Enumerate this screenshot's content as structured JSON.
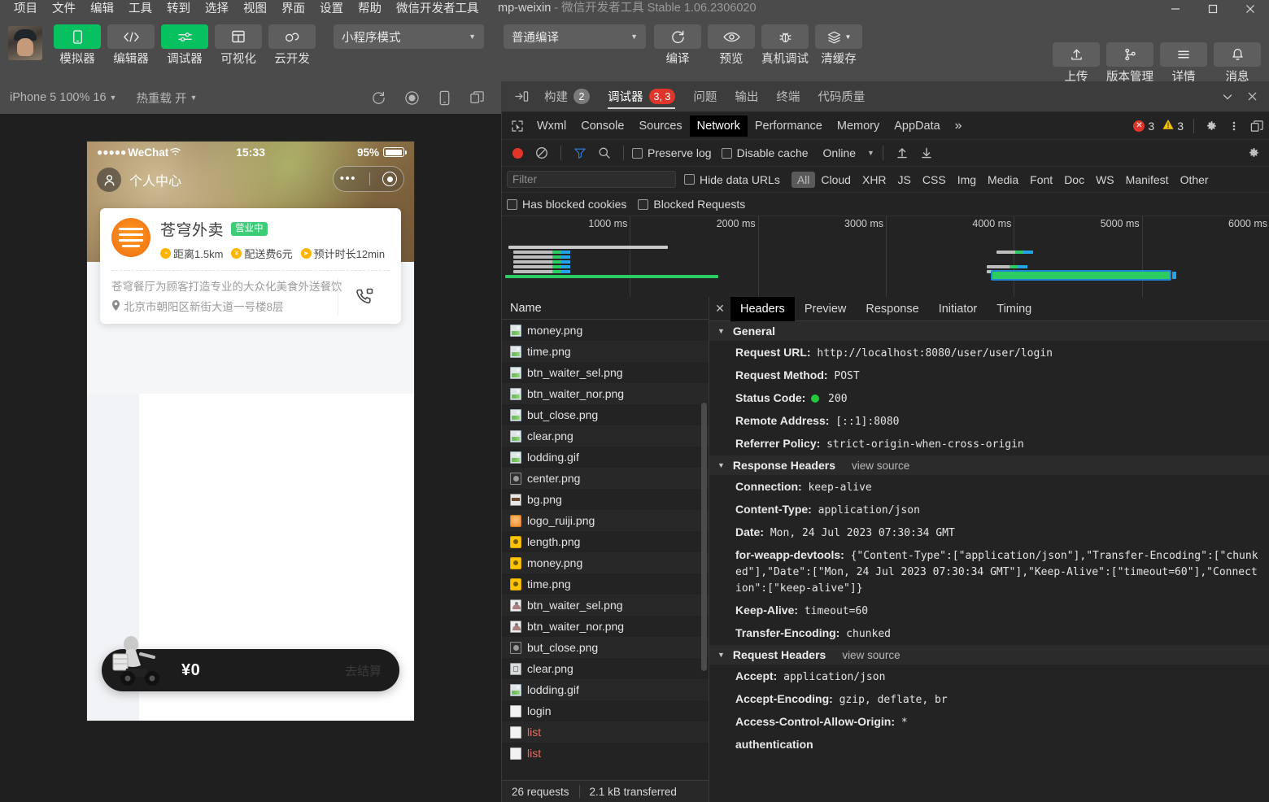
{
  "titlebar": {
    "menus": [
      "项目",
      "文件",
      "编辑",
      "工具",
      "转到",
      "选择",
      "视图",
      "界面",
      "设置",
      "帮助",
      "微信开发者工具"
    ],
    "project": "mp-weixin",
    "app_title": "微信开发者工具 Stable 1.06.2306020",
    "minimize": "—",
    "maximize": "▢",
    "close": "✕"
  },
  "toolbar": {
    "left_buttons": [
      {
        "label": "模拟器",
        "icon": "phone-icon",
        "accent": true
      },
      {
        "label": "编辑器",
        "icon": "code-icon",
        "accent": false
      },
      {
        "label": "调试器",
        "icon": "sliders-icon",
        "accent": true
      },
      {
        "label": "可视化",
        "icon": "layout-icon",
        "accent": false
      },
      {
        "label": "云开发",
        "icon": "cloud-icon",
        "accent": false
      }
    ],
    "mode_select": "小程序模式",
    "compile_select": "普通编译",
    "compile_buttons": [
      {
        "label": "编译",
        "icon": "refresh-icon"
      },
      {
        "label": "预览",
        "icon": "eye-icon"
      },
      {
        "label": "真机调试",
        "icon": "bug-icon"
      },
      {
        "label": "清缓存",
        "icon": "layers-icon"
      }
    ],
    "right_buttons": [
      {
        "label": "上传",
        "icon": "upload-icon"
      },
      {
        "label": "版本管理",
        "icon": "branch-icon"
      },
      {
        "label": "详情",
        "icon": "menu-icon"
      },
      {
        "label": "消息",
        "icon": "bell-icon"
      }
    ]
  },
  "simulator": {
    "device_select": "iPhone 5 100% 16",
    "hotreload_select": "热重载 开",
    "icons": [
      "refresh-icon",
      "record-icon",
      "device-icon",
      "windows-icon"
    ],
    "status": {
      "carrier": "WeChat",
      "dots": "●●●●●",
      "wifi": "wifi-icon",
      "time": "15:33",
      "battery_pct": "95%"
    },
    "nav": {
      "title": "个人中心",
      "avatar_icon": "user-icon",
      "capsule_dots": "•••",
      "capsule_target": "target-icon"
    },
    "shop": {
      "name": "苍穹外卖",
      "badge": "营业中",
      "meta": [
        {
          "icon": "clock-icon",
          "text": "距离1.5km"
        },
        {
          "icon": "yuan-icon",
          "text": "配送费6元"
        },
        {
          "icon": "send-icon",
          "text": "预计时长12min"
        }
      ],
      "desc": "苍穹餐厅为顾客打造专业的大众化美食外送餐饮",
      "address": "北京市朝阳区新街大道一号楼8层",
      "phone_icon": "phone-call-icon"
    },
    "cart": {
      "price": "¥0",
      "action": "去结算"
    }
  },
  "devtools": {
    "outer_tabs": [
      {
        "label": "构建",
        "badge": "2",
        "badge_color": "gray",
        "active": false
      },
      {
        "label": "调试器",
        "badge": "3, 3",
        "badge_color": "red",
        "active": true
      },
      {
        "label": "问题",
        "badge": "",
        "active": false
      },
      {
        "label": "输出",
        "badge": "",
        "active": false
      },
      {
        "label": "终端",
        "badge": "",
        "active": false
      },
      {
        "label": "代码质量",
        "badge": "",
        "active": false
      }
    ],
    "outer_right_icons": [
      "chevron-down-icon",
      "close-icon"
    ],
    "panel_tabs": [
      {
        "label": "Wxml",
        "active": false
      },
      {
        "label": "Console",
        "active": false
      },
      {
        "label": "Sources",
        "active": false
      },
      {
        "label": "Network",
        "active": true
      },
      {
        "label": "Performance",
        "active": false
      },
      {
        "label": "Memory",
        "active": false
      },
      {
        "label": "AppData",
        "active": false
      }
    ],
    "panel_more": "»",
    "error_count": "3",
    "warning_count": "3",
    "panel_right_icons": [
      "gear-icon",
      "kebab-icon",
      "dock-icon"
    ],
    "network_toolbar": {
      "record_icon": "record-icon",
      "clear_icon": "clear-icon",
      "filter_icon": "filter-icon",
      "search_icon": "search-icon",
      "preserve_log": "Preserve log",
      "disable_cache": "Disable cache",
      "throttling": "Online",
      "import_icon": "upload-arrow-icon",
      "export_icon": "download-arrow-icon",
      "settings_icon": "gear-icon"
    },
    "filter_row": {
      "placeholder": "Filter",
      "hide_data_urls": "Hide data URLs",
      "types": [
        "All",
        "Cloud",
        "XHR",
        "JS",
        "CSS",
        "Img",
        "Media",
        "Font",
        "Doc",
        "WS",
        "Manifest",
        "Other"
      ],
      "active_type": "All"
    },
    "blocked_row": {
      "has_blocked_cookies": "Has blocked cookies",
      "blocked_requests": "Blocked Requests"
    },
    "overview": {
      "ticks": [
        "1000 ms",
        "2000 ms",
        "3000 ms",
        "4000 ms",
        "5000 ms",
        "6000 ms"
      ],
      "max_ms": 6000
    },
    "list": {
      "header": "Name",
      "rows": [
        {
          "name": "money.png",
          "icon": "image-icon",
          "error": false
        },
        {
          "name": "time.png",
          "icon": "image-icon",
          "error": false
        },
        {
          "name": "btn_waiter_sel.png",
          "icon": "image-icon",
          "error": false
        },
        {
          "name": "btn_waiter_nor.png",
          "icon": "image-icon",
          "error": false
        },
        {
          "name": "but_close.png",
          "icon": "image-icon",
          "error": false
        },
        {
          "name": "clear.png",
          "icon": "image-icon",
          "error": false
        },
        {
          "name": "lodding.gif",
          "icon": "image-icon",
          "error": false
        },
        {
          "name": "center.png",
          "icon": "circle-icon",
          "error": false
        },
        {
          "name": "bg.png",
          "icon": "bg-icon",
          "error": false
        },
        {
          "name": "logo_ruiji.png",
          "icon": "orange-icon",
          "error": false
        },
        {
          "name": "length.png",
          "icon": "yellow-icon",
          "error": false
        },
        {
          "name": "money.png",
          "icon": "yellow-icon",
          "error": false
        },
        {
          "name": "time.png",
          "icon": "yellow-icon",
          "error": false
        },
        {
          "name": "btn_waiter_sel.png",
          "icon": "person-icon",
          "error": false
        },
        {
          "name": "btn_waiter_nor.png",
          "icon": "person-icon",
          "error": false
        },
        {
          "name": "but_close.png",
          "icon": "circle-icon",
          "error": false
        },
        {
          "name": "clear.png",
          "icon": "clear-icon",
          "error": false
        },
        {
          "name": "lodding.gif",
          "icon": "image-icon",
          "error": false
        },
        {
          "name": "login",
          "icon": "doc-icon",
          "error": false
        },
        {
          "name": "list",
          "icon": "doc-icon",
          "error": true
        },
        {
          "name": "list",
          "icon": "doc-icon",
          "error": true
        }
      ],
      "footer": {
        "requests": "26 requests",
        "transferred": "2.1 kB transferred"
      }
    },
    "detail": {
      "tabs": [
        {
          "label": "Headers",
          "active": true
        },
        {
          "label": "Preview",
          "active": false
        },
        {
          "label": "Response",
          "active": false
        },
        {
          "label": "Initiator",
          "active": false
        },
        {
          "label": "Timing",
          "active": false
        }
      ],
      "close_icon": "close-icon",
      "sections": [
        {
          "title": "General",
          "view_source": "",
          "rows": [
            {
              "key": "Request URL:",
              "value": "http://localhost:8080/user/user/login"
            },
            {
              "key": "Request Method:",
              "value": "POST"
            },
            {
              "key": "Status Code:",
              "value": "200",
              "status_dot": true
            },
            {
              "key": "Remote Address:",
              "value": "[::1]:8080"
            },
            {
              "key": "Referrer Policy:",
              "value": "strict-origin-when-cross-origin"
            }
          ]
        },
        {
          "title": "Response Headers",
          "view_source": "view source",
          "rows": [
            {
              "key": "Connection:",
              "value": "keep-alive"
            },
            {
              "key": "Content-Type:",
              "value": "application/json"
            },
            {
              "key": "Date:",
              "value": "Mon, 24 Jul 2023 07:30:34 GMT"
            },
            {
              "key": "for-weapp-devtools:",
              "value": "{\"Content-Type\":[\"application/json\"],\"Transfer-Encoding\":[\"chunked\"],\"Date\":[\"Mon, 24 Jul 2023 07:30:34 GMT\"],\"Keep-Alive\":[\"timeout=60\"],\"Connection\":[\"keep-alive\"]}"
            },
            {
              "key": "Keep-Alive:",
              "value": "timeout=60"
            },
            {
              "key": "Transfer-Encoding:",
              "value": "chunked"
            }
          ]
        },
        {
          "title": "Request Headers",
          "view_source": "view source",
          "rows": [
            {
              "key": "Accept:",
              "value": "application/json"
            },
            {
              "key": "Accept-Encoding:",
              "value": "gzip, deflate, br"
            },
            {
              "key": "Access-Control-Allow-Origin:",
              "value": "*"
            },
            {
              "key": "authentication",
              "value": ""
            }
          ]
        }
      ]
    }
  },
  "colors": {
    "accent_green": "#07c160",
    "error_red": "#e0352b",
    "badge_green": "#3ecc79",
    "brand_orange": "#f47b16",
    "panel_bg": "#232323",
    "chrome_bg": "#4b4b4b"
  }
}
